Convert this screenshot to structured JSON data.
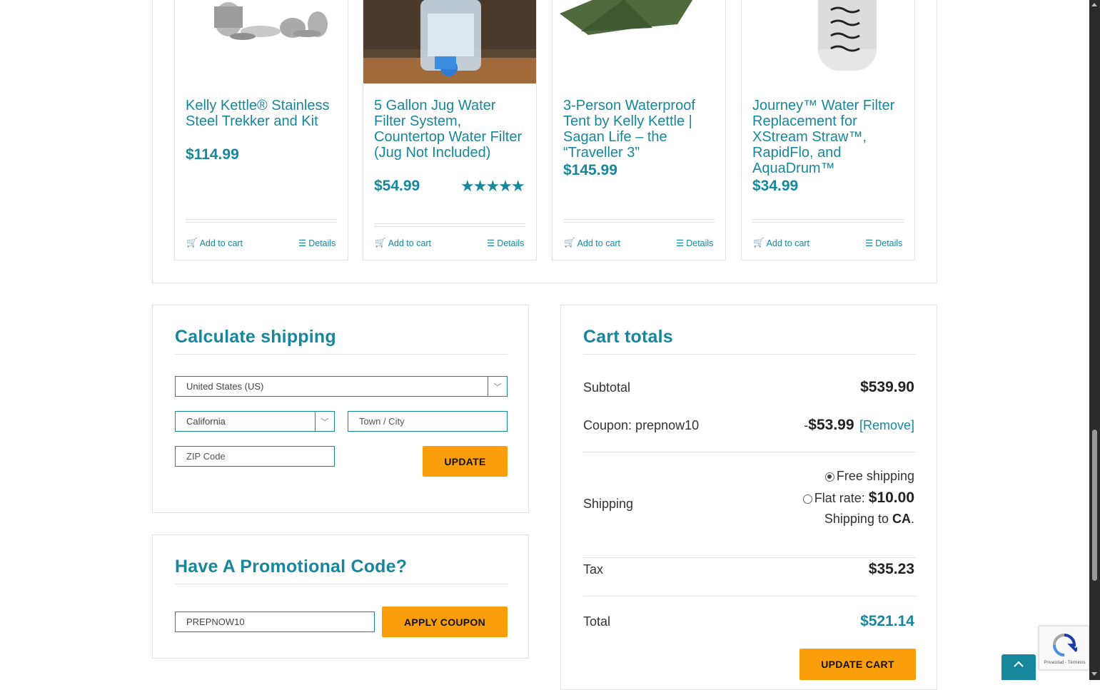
{
  "products": [
    {
      "title": "Kelly Kettle® Stainless Steel Trekker and Kit",
      "price": "$114.99",
      "add_label": "Add to cart",
      "details_label": "Details"
    },
    {
      "title": "5 Gallon Jug Water Filter System, Countertop Water Filter (Jug Not Included)",
      "price": "$54.99",
      "rating_stars": "★★★★★",
      "rating_value": 4.8,
      "add_label": "Add to cart",
      "details_label": "Details"
    },
    {
      "title": "3-Person Waterproof Tent by Kelly Kettle | Sagan Life – the “Traveller 3”",
      "price": "$145.99",
      "add_label": "Add to cart",
      "details_label": "Details"
    },
    {
      "title": "Journey™ Water Filter Replacement for XStream Straw™, RapidFlo, and AquaDrum™",
      "price": "$34.99",
      "add_label": "Add to cart",
      "details_label": "Details"
    }
  ],
  "shipping_calc": {
    "title": "Calculate shipping",
    "country": "United States (US)",
    "state": "California",
    "city_placeholder": "Town / City",
    "zip_placeholder": "ZIP Code",
    "update_label": "UPDATE"
  },
  "promo": {
    "title": "Have A Promotional Code?",
    "code_value": "PREPNOW10",
    "apply_label": "APPLY COUPON"
  },
  "cart_totals": {
    "title": "Cart totals",
    "subtotal_label": "Subtotal",
    "subtotal_value": "$539.90",
    "coupon_label": "Coupon: prepnow10",
    "coupon_prefix": "-",
    "coupon_value": "$53.99",
    "remove_label": "[Remove]",
    "shipping_label": "Shipping",
    "free_shipping_label": "Free shipping",
    "flat_rate_label": "Flat rate:",
    "flat_rate_value": "$10.00",
    "shipping_to_label": "Shipping to",
    "shipping_to_value": "CA",
    "shipping_to_suffix": ".",
    "tax_label": "Tax",
    "tax_value": "$35.23",
    "total_label": "Total",
    "total_value": "$521.14",
    "update_cart_label": "UPDATE CART"
  },
  "recaptcha": {
    "footer": "Privacidad - Términos"
  },
  "colors": {
    "accent": "#16879d",
    "button": "#fb9e0c",
    "border": "#e2e2e2"
  }
}
